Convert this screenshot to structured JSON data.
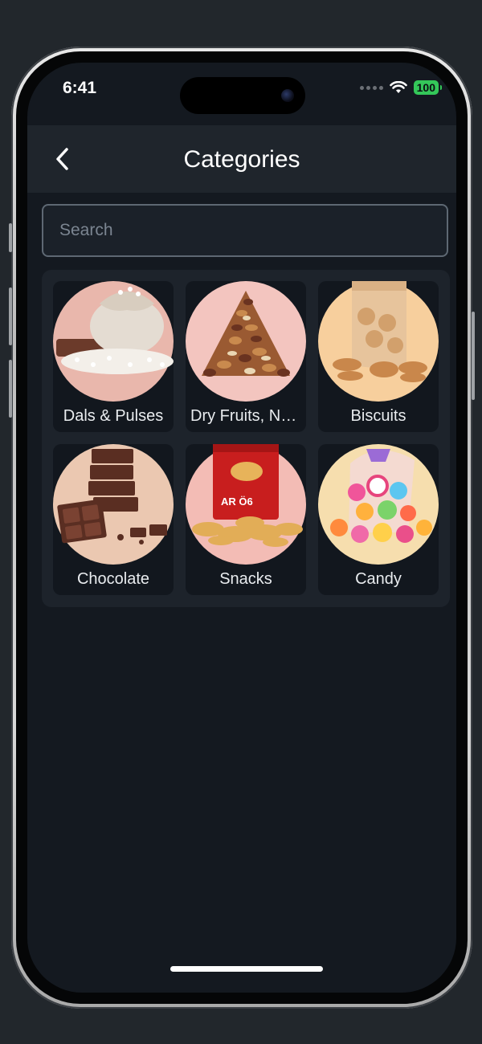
{
  "status_bar": {
    "time": "6:41",
    "battery": "100",
    "battery_color": "#34c759"
  },
  "header": {
    "back_icon": "chevron-left-icon",
    "title": "Categories"
  },
  "search": {
    "placeholder": "Search",
    "value": ""
  },
  "categories": [
    {
      "label": "Dals & Pulses",
      "icon": "dals-pulses-image",
      "bg": "#e9b7ac"
    },
    {
      "label": "Dry Fruits, Nu...",
      "icon": "dry-fruits-image",
      "bg": "#f3c5bf"
    },
    {
      "label": "Biscuits",
      "icon": "biscuits-image",
      "bg": "#f7cf9d"
    },
    {
      "label": "Chocolate",
      "icon": "chocolate-image",
      "bg": "#ebc8b1"
    },
    {
      "label": "Snacks",
      "icon": "snacks-image",
      "bg": "#f3bcb5"
    },
    {
      "label": "Candy",
      "icon": "candy-image",
      "bg": "#f6deae"
    }
  ],
  "colors": {
    "background": "#22272c",
    "screen": "#141920",
    "navbar": "#1f252c",
    "panel": "#1d232b"
  }
}
